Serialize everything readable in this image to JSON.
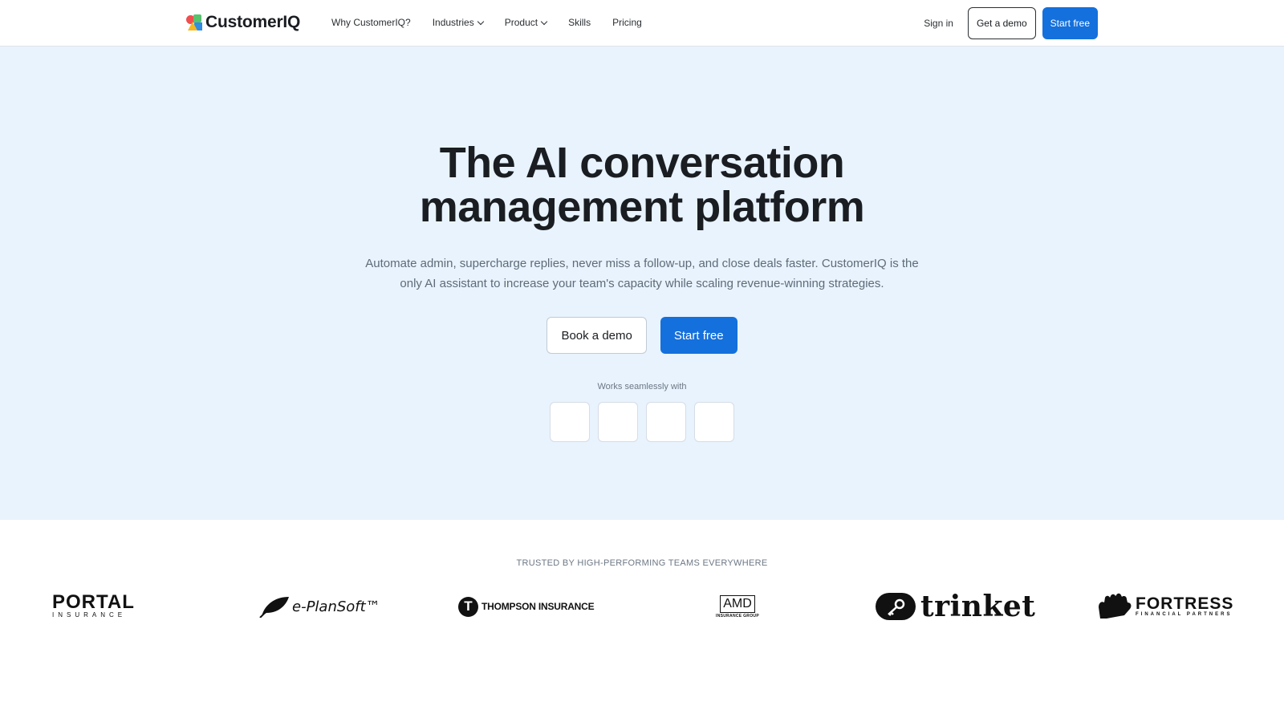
{
  "brand": {
    "name": "CustomerIQ",
    "colors": {
      "primary": "#1470dc",
      "hero_bg": "#e8f3fe",
      "logo_red": "#ef4f4f",
      "logo_green": "#58c26d",
      "logo_yellow": "#f5b823",
      "logo_blue": "#2f8de4"
    }
  },
  "nav": {
    "items": [
      {
        "label": "Why CustomerIQ?",
        "has_dropdown": false
      },
      {
        "label": "Industries",
        "has_dropdown": true
      },
      {
        "label": "Product",
        "has_dropdown": true
      },
      {
        "label": "Skills",
        "has_dropdown": false
      },
      {
        "label": "Pricing",
        "has_dropdown": false
      }
    ],
    "sign_in": "Sign in",
    "get_demo": "Get a demo",
    "start_free": "Start free"
  },
  "hero": {
    "title_line1": "The AI conversation",
    "title_line2": "management platform",
    "subtitle_line1": "Automate admin, supercharge replies, never miss a follow-up, and close deals faster. CustomerIQ is the",
    "subtitle_line2": "only AI assistant to increase your team's capacity while scaling revenue-winning strategies.",
    "book_demo": "Book a demo",
    "start_free": "Start free",
    "works_with": "Works seamlessly with",
    "integration_tiles": 4
  },
  "trusted": {
    "heading": "TRUSTED BY HIGH-PERFORMING TEAMS EVERYWHERE",
    "logos": [
      {
        "name": "PORTAL",
        "sub": "INSURANCE"
      },
      {
        "name": "e-PlanSoft™"
      },
      {
        "name": "THOMPSON INSURANCE",
        "mark": "T"
      },
      {
        "name": "AMD",
        "sub": "INSURANCE GROUP"
      },
      {
        "name": "trinket"
      },
      {
        "name": "FORTRESS",
        "sub": "FINANCIAL PARTNERS"
      }
    ]
  }
}
